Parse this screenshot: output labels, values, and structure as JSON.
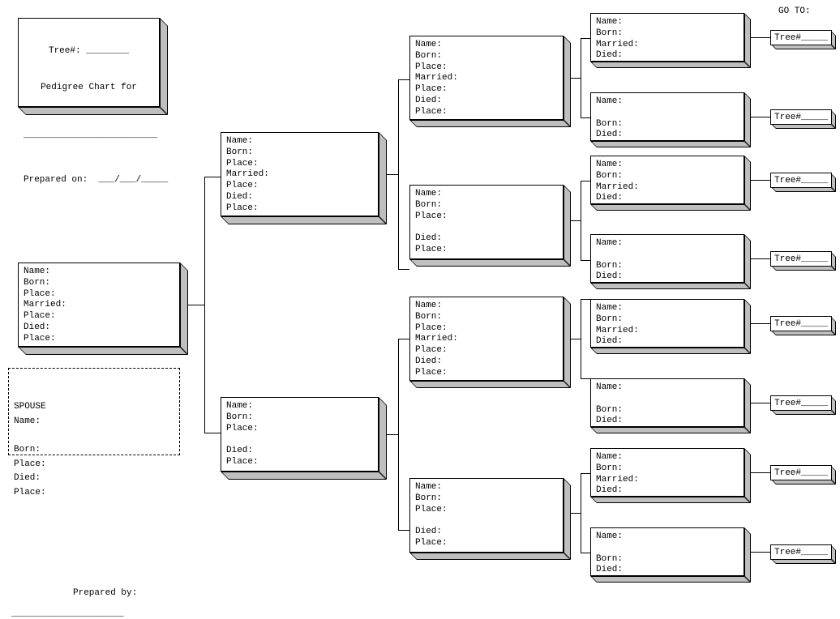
{
  "header": {
    "tree_no_label": "Tree#:",
    "tree_no_blank": "________",
    "title": "Pedigree Chart for",
    "name_line": "_________________________",
    "prepared_on": "Prepared on:  ___/___/_____"
  },
  "goto_label": "GO TO:",
  "tree_ref": "Tree#_____",
  "fields": {
    "full": "Name:\nBorn:\nPlace:\nMarried:\nPlace:\nDied:\nPlace:",
    "female": "Name:\nBorn:\nPlace:\n\nDied:\nPlace:",
    "g4m": "Name:\nBorn:\nMarried:\nDied:",
    "g4f": "Name:\n\nBorn:\nDied:"
  },
  "spouse": {
    "title": "SPOUSE",
    "body": "Name:\n\nBorn:\nPlace:\nDied:\nPlace:"
  },
  "footer": {
    "prepared_by": "Prepared by:",
    "line": "_____________________"
  }
}
